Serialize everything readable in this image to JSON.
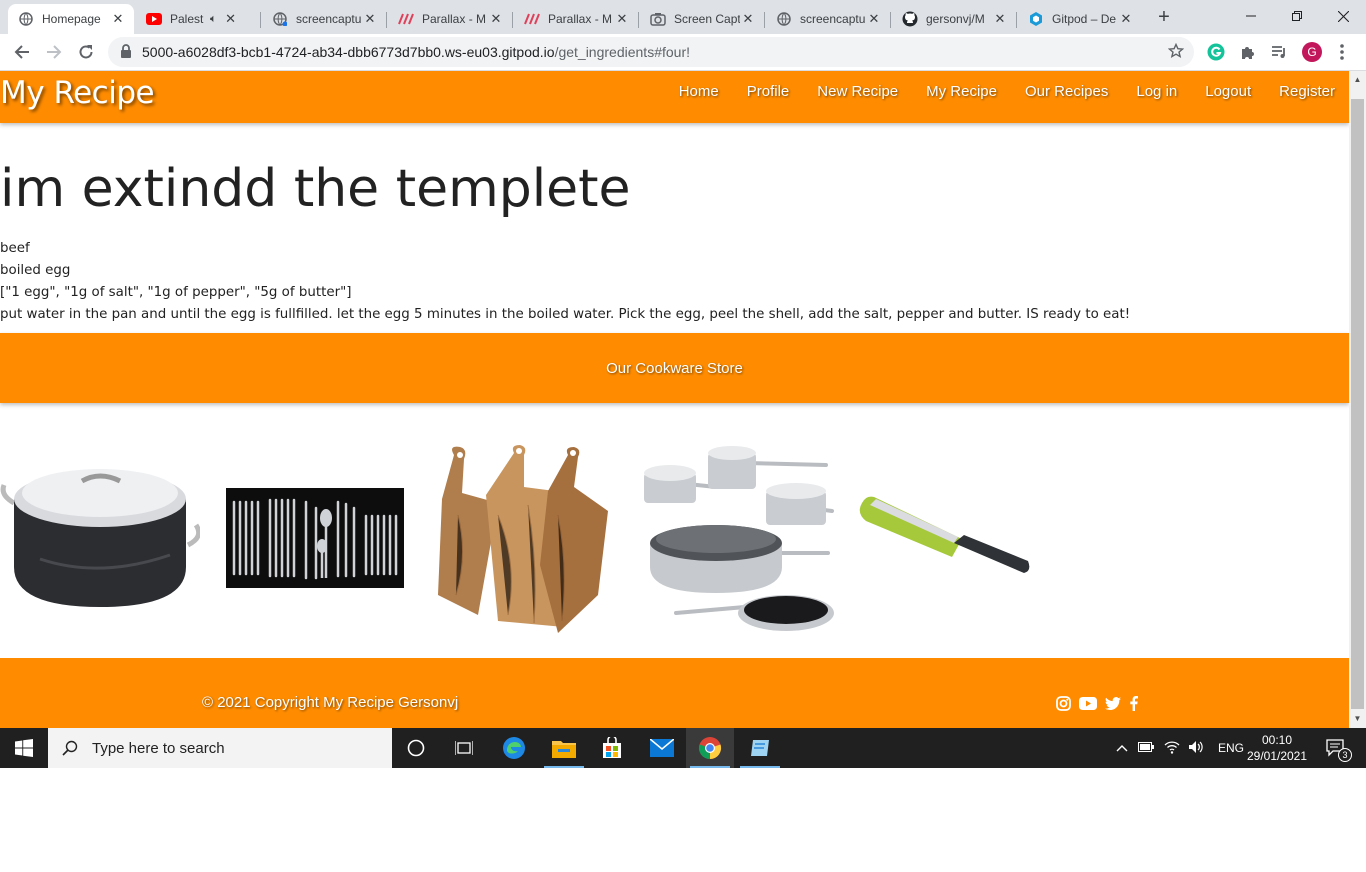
{
  "browser": {
    "tabs": [
      {
        "title": "Homepage",
        "active": true,
        "favicon": "globe-icon"
      },
      {
        "title": "Palestra",
        "active": false,
        "favicon": "youtube-icon",
        "muted_icon": "speaker-icon"
      },
      {
        "title": "screencaptu",
        "active": false,
        "favicon": "globe-icon"
      },
      {
        "title": "Parallax - M",
        "active": false,
        "favicon": "parallax-icon"
      },
      {
        "title": "Parallax - M",
        "active": false,
        "favicon": "parallax-icon"
      },
      {
        "title": "Screen Capt",
        "active": false,
        "favicon": "camera-icon"
      },
      {
        "title": "screencaptu",
        "active": false,
        "favicon": "globe-icon"
      },
      {
        "title": "gersonvj/M",
        "active": false,
        "favicon": "github-icon"
      },
      {
        "title": "Gitpod – De",
        "active": false,
        "favicon": "gitpod-icon"
      }
    ],
    "url_host": "5000-a6028df3-bcb1-4724-ab34-dbb6773d7bb0.ws-eu03.gitpod.io",
    "url_path": "/get_ingredients#four!",
    "profile_initial": "G"
  },
  "site": {
    "brand": "My Recipe",
    "nav": [
      "Home",
      "Profile",
      "New Recipe",
      "My Recipe",
      "Our Recipes",
      "Log in",
      "Logout",
      "Register"
    ],
    "heading": "im extindd the templete",
    "lines": [
      "beef",
      "boiled egg",
      "[\"1 egg\", \"1g of salt\", \"1g of pepper\", \"5g of butter\"]",
      "put water in the pan and until the egg is fullfilled. let the egg 5 minutes in the boiled water. Pick the egg, peel the shell, add the salt, pepper and butter. IS ready to eat!"
    ],
    "store_title": "Our Cookware Store",
    "products": [
      "stockpot",
      "cutlery-set",
      "chopping-boards",
      "pan-set",
      "grater"
    ],
    "footer_copyright": "© 2021 Copyright My Recipe Gersonvj",
    "social": [
      "instagram-icon",
      "youtube-icon",
      "twitter-icon",
      "facebook-icon"
    ],
    "accent_color": "#ff8c00"
  },
  "taskbar": {
    "search_placeholder": "Type here to search",
    "language": "ENG",
    "time": "00:10",
    "date": "29/01/2021",
    "notification_count": "3"
  }
}
